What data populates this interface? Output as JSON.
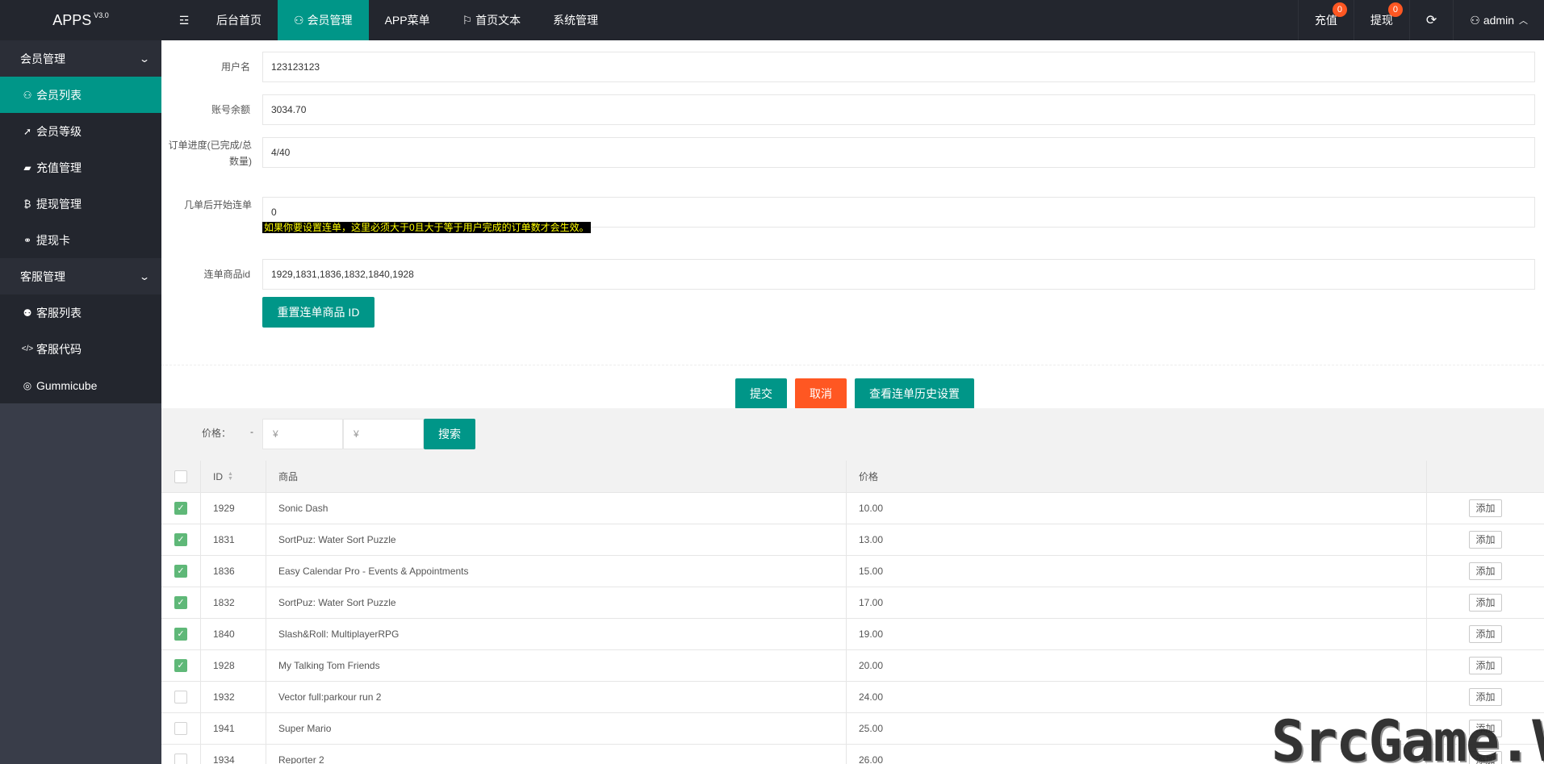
{
  "header": {
    "logo": "APPS",
    "version": "V3.0",
    "menu_toggle_icon": "☲",
    "nav": [
      {
        "label": "后台首页",
        "icon": ""
      },
      {
        "label": "会员管理",
        "icon": "person-icon"
      },
      {
        "label": "APP菜单",
        "icon": ""
      },
      {
        "label": "首页文本",
        "icon": "flag-icon"
      },
      {
        "label": "系统管理",
        "icon": ""
      }
    ],
    "recharge_label": "充值",
    "recharge_badge": "0",
    "withdraw_label": "提现",
    "withdraw_badge": "0",
    "refresh_icon": "⟳",
    "user": "admin"
  },
  "sidebar": {
    "groups": [
      {
        "label": "会员管理",
        "items": [
          {
            "label": "会员列表",
            "icon": "person-icon",
            "glyph": "⚇"
          },
          {
            "label": "会员等级",
            "icon": "rocket-icon",
            "glyph": "➚"
          },
          {
            "label": "充值管理",
            "icon": "chat-icon",
            "glyph": "▰"
          },
          {
            "label": "提现管理",
            "icon": "bitcoin-icon",
            "glyph": "₿"
          },
          {
            "label": "提现卡",
            "icon": "link-icon",
            "glyph": "⚭"
          }
        ]
      },
      {
        "label": "客服管理",
        "items": [
          {
            "label": "客服列表",
            "icon": "users-icon",
            "glyph": "⚉"
          },
          {
            "label": "客服代码",
            "icon": "code-icon",
            "glyph": "</>"
          },
          {
            "label": "Gummicube",
            "icon": "eye-icon",
            "glyph": "◎"
          }
        ]
      }
    ]
  },
  "form": {
    "username_label": "用户名",
    "username_value": "123123123",
    "balance_label": "账号余额",
    "balance_value": "3034.70",
    "progress_label": "订单进度(已完成/总数量)",
    "progress_value": "4/40",
    "start_label": "几单后开始连单",
    "start_value": "0",
    "start_hint": "如果你要设置连单，这里必须大于0且大于等于用户完成的订单数才会生效。",
    "goods_label": "连单商品id",
    "goods_value": "1929,1831,1836,1832,1840,1928",
    "reset_button": "重置连单商品 ID",
    "submit_button": "提交",
    "cancel_button": "取消",
    "history_button": "查看连单历史设置"
  },
  "search": {
    "price_label": "价格：",
    "dash": "-",
    "min_placeholder": "¥",
    "max_placeholder": "¥",
    "search_button": "搜索"
  },
  "table": {
    "columns": [
      "ID",
      "商品",
      "价格",
      ""
    ],
    "add_label": "添加",
    "rows": [
      {
        "id": "1929",
        "name": "Sonic Dash",
        "price": "10.00",
        "checked": true
      },
      {
        "id": "1831",
        "name": "SortPuz: Water Sort Puzzle",
        "price": "13.00",
        "checked": true
      },
      {
        "id": "1836",
        "name": "Easy Calendar Pro - Events & Appointments",
        "price": "15.00",
        "checked": true
      },
      {
        "id": "1832",
        "name": "SortPuz: Water Sort Puzzle",
        "price": "17.00",
        "checked": true
      },
      {
        "id": "1840",
        "name": "Slash&Roll: MultiplayerRPG",
        "price": "19.00",
        "checked": true
      },
      {
        "id": "1928",
        "name": "My Talking Tom Friends",
        "price": "20.00",
        "checked": true
      },
      {
        "id": "1932",
        "name": "Vector full:parkour run 2",
        "price": "24.00",
        "checked": false
      },
      {
        "id": "1941",
        "name": "Super Mario",
        "price": "25.00",
        "checked": false
      },
      {
        "id": "1934",
        "name": "Reporter 2",
        "price": "26.00",
        "checked": false
      }
    ]
  },
  "watermark": "SrcGame.Vip",
  "colors": {
    "primary": "#009688",
    "warn": "#ff5722",
    "header_bg": "#23262e",
    "sidebar_bg": "#393d49",
    "checked": "#5fb878"
  }
}
